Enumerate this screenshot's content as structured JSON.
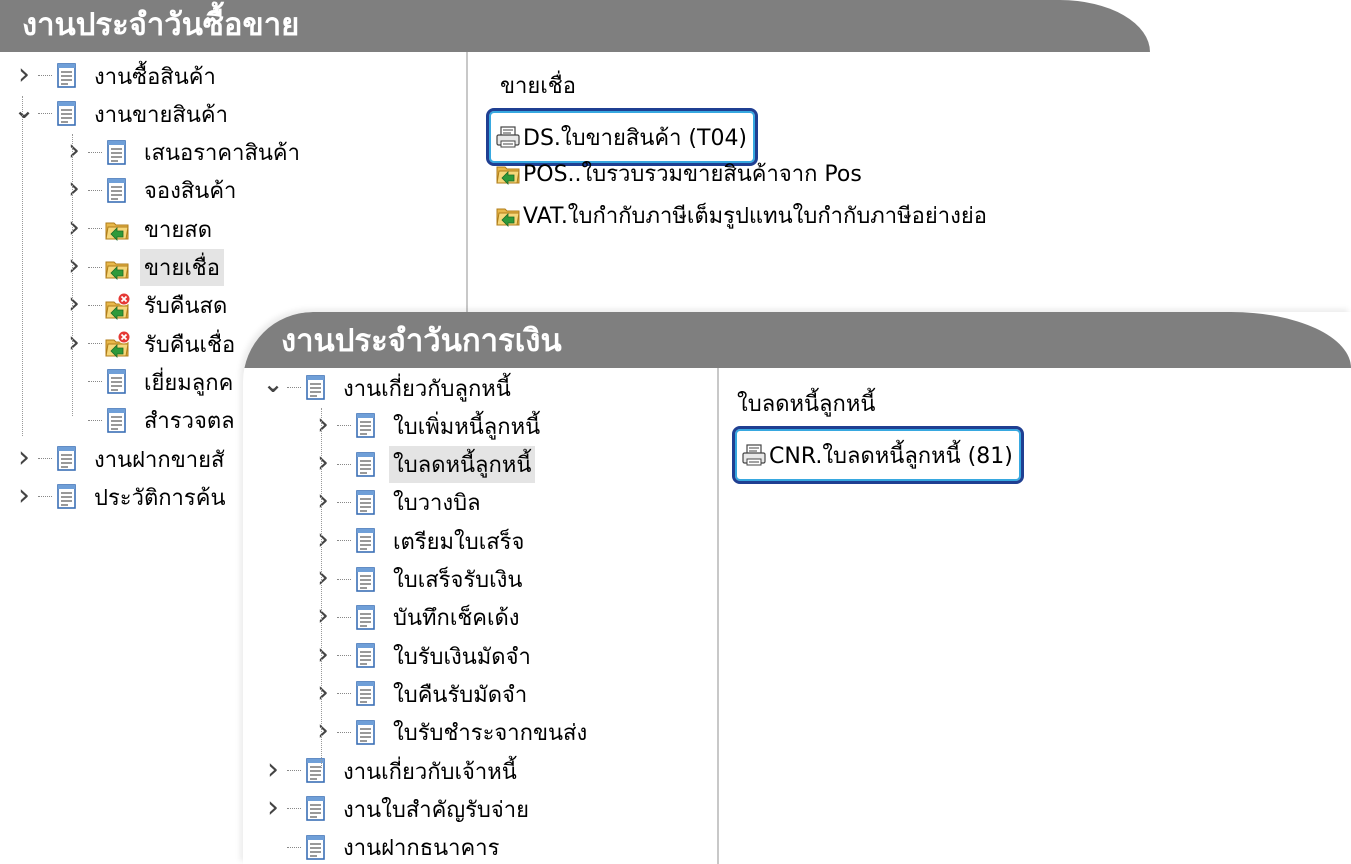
{
  "panel_top": {
    "title": "งานประจำวันซื้อขาย",
    "tree": [
      {
        "label": "งานซื้อสินค้า",
        "expander": "›",
        "icon": "document-icon",
        "level": 0
      },
      {
        "label": "งานขายสินค้า",
        "expander": "⌄",
        "icon": "document-icon",
        "level": 0
      },
      {
        "label": "เสนอราคาสินค้า",
        "expander": "›",
        "icon": "document-icon",
        "level": 1
      },
      {
        "label": "จองสินค้า",
        "expander": "›",
        "icon": "document-icon",
        "level": 1
      },
      {
        "label": "ขายสด",
        "expander": "›",
        "icon": "open-folder-icon",
        "level": 1
      },
      {
        "label": "ขายเชื่อ",
        "expander": "›",
        "icon": "open-folder-icon",
        "level": 1,
        "selected": true
      },
      {
        "label": "รับคืนสด",
        "expander": "›",
        "icon": "return-folder-icon",
        "level": 1
      },
      {
        "label": "รับคืนเชื่อ",
        "expander": "›",
        "icon": "return-folder-icon",
        "level": 1
      },
      {
        "label": "เยี่ยมลูกค",
        "expander": "",
        "icon": "document-icon",
        "level": 1
      },
      {
        "label": "สำรวจตล",
        "expander": "",
        "icon": "document-icon",
        "level": 1
      },
      {
        "label": "งานฝากขายสั",
        "expander": "›",
        "icon": "document-icon",
        "level": 0
      },
      {
        "label": "ประวัติการค้น",
        "expander": "›",
        "icon": "document-icon",
        "level": 0
      }
    ],
    "right_title": "ขายเชื่อ",
    "items": [
      {
        "label": "DS.ใบขายสินค้า (T04)",
        "icon": "printer-form-icon",
        "highlighted": true
      },
      {
        "label": "POS..ใบรวบรวมขายสินค้าจาก Pos",
        "icon": "open-folder-icon"
      },
      {
        "label": "VAT.ใบกำกับภาษีเต็มรูปแทนใบกำกับภาษีอย่างย่อ",
        "icon": "open-folder-icon"
      }
    ]
  },
  "panel_bottom": {
    "title": "งานประจำวันการเงิน",
    "tree": [
      {
        "label": "งานเกี่ยวกับลูกหนี้",
        "expander": "⌄",
        "icon": "document-icon",
        "level": 0
      },
      {
        "label": "ใบเพิ่มหนี้ลูกหนี้",
        "expander": "›",
        "icon": "document-icon",
        "level": 1
      },
      {
        "label": "ใบลดหนี้ลูกหนี้",
        "expander": "›",
        "icon": "document-icon",
        "level": 1,
        "selected": true
      },
      {
        "label": "ใบวางบิล",
        "expander": "›",
        "icon": "document-icon",
        "level": 1
      },
      {
        "label": "เตรียมใบเสร็จ",
        "expander": "›",
        "icon": "document-icon",
        "level": 1
      },
      {
        "label": "ใบเสร็จรับเงิน",
        "expander": "›",
        "icon": "document-icon",
        "level": 1
      },
      {
        "label": "บันทึกเช็คเด้ง",
        "expander": "›",
        "icon": "document-icon",
        "level": 1
      },
      {
        "label": "ใบรับเงินมัดจำ",
        "expander": "›",
        "icon": "document-icon",
        "level": 1
      },
      {
        "label": "ใบคืนรับมัดจำ",
        "expander": "›",
        "icon": "document-icon",
        "level": 1
      },
      {
        "label": "ใบรับชำระจากขนส่ง",
        "expander": "›",
        "icon": "document-icon",
        "level": 1
      },
      {
        "label": "งานเกี่ยวกับเจ้าหนี้",
        "expander": "›",
        "icon": "document-icon",
        "level": 0
      },
      {
        "label": "งานใบสำคัญรับจ่าย",
        "expander": "›",
        "icon": "document-icon",
        "level": 0
      },
      {
        "label": "งานฝากธนาคาร",
        "expander": "",
        "icon": "document-icon",
        "level": 0
      }
    ],
    "right_title": "ใบลดหนี้ลูกหนี้",
    "items": [
      {
        "label": "CNR.ใบลดหนี้ลูกหนี้ (81)",
        "icon": "printer-form-icon",
        "highlighted": true
      }
    ]
  },
  "colors": {
    "titlebar": "#7f7f7f",
    "callout_outer": "#1f3f92",
    "callout_inner": "#37a8e0",
    "selected_row": "#e4e4e4"
  }
}
